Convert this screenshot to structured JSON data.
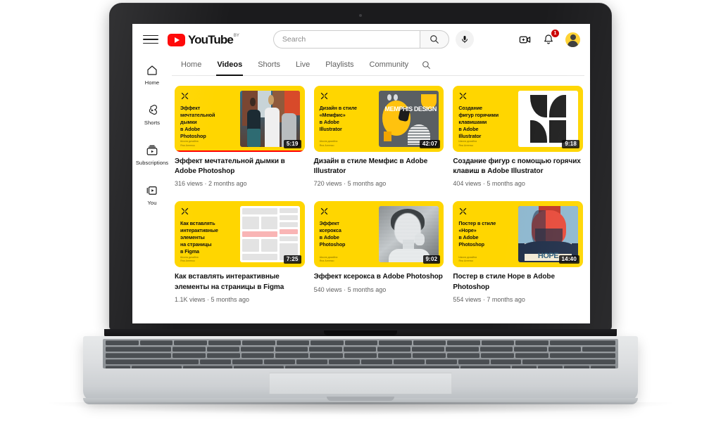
{
  "topbar": {
    "menu_icon": "hamburger-menu-icon",
    "logo_text": "YouTube",
    "logo_country_suffix": "BY",
    "search_placeholder": "Search",
    "search_value": "",
    "search_icon": "search-icon",
    "voice_icon": "microphone-icon",
    "create_icon": "create-video-icon",
    "notifications_icon": "bell-icon",
    "notifications_count": "1",
    "avatar_icon": "user-avatar"
  },
  "sidebar": {
    "items": [
      {
        "label": "Home",
        "icon": "home-icon"
      },
      {
        "label": "Shorts",
        "icon": "shorts-icon"
      },
      {
        "label": "Subscriptions",
        "icon": "subscriptions-icon"
      },
      {
        "label": "You",
        "icon": "you-library-icon"
      }
    ]
  },
  "channel_tabs": {
    "items": [
      {
        "label": "Home",
        "active": false
      },
      {
        "label": "Videos",
        "active": true
      },
      {
        "label": "Shorts",
        "active": false
      },
      {
        "label": "Live",
        "active": false
      },
      {
        "label": "Playlists",
        "active": false
      },
      {
        "label": "Community",
        "active": false
      }
    ],
    "search_icon": "search-icon"
  },
  "videos": [
    {
      "thumb_title": "Эффект\nмечтательной\nдымки\nв Adobe\nPhotoshop",
      "thumb_sub": "Школа дизайна\nЯна Агеенко",
      "duration": "5:19",
      "title": "Эффект мечтательной дымки в Adobe Photoshop",
      "meta": "316 views · 2 months ago",
      "progress_percent": 100,
      "art": "mural"
    },
    {
      "thumb_title": "Дизайн в стиле\n«Мемфис»\nв Adobe\nIllustrator",
      "thumb_sub": "Школа дизайна\nЯна Агеенко",
      "duration": "42:07",
      "title": "Дизайн в стиле Мемфис в Adobe Illustrator",
      "meta": "720 views · 5 months ago",
      "progress_percent": 0,
      "art": "memphis",
      "art_text": "MEMPHIS DESIGN"
    },
    {
      "thumb_title": "Создание\nфигур горячими\nклавишами\nв Adobe\nIllustrator",
      "thumb_sub": "Школа дизайна\nЯна Агеенко",
      "duration": "9:18",
      "title": "Создание фигур с помощью горячих клавиш в Adobe Illustrator",
      "meta": "404 views · 5 months ago",
      "progress_percent": 0,
      "art": "shapes"
    },
    {
      "thumb_title": "Как вставлять\nинтерактивные\nэлементы\nна страницы\nв Figma",
      "thumb_sub": "Школа дизайна\nЯна Агеенко",
      "duration": "7:25",
      "title": "Как вставлять интерактивные элементы на страницы в Figma",
      "meta": "1.1K views · 5 months ago",
      "progress_percent": 0,
      "art": "wireframe"
    },
    {
      "thumb_title": "Эффект\nксерокса\nв Adobe\nPhotoshop",
      "thumb_sub": "Школа дизайна\nЯна Агеенко",
      "duration": "9:02",
      "title": "Эффект ксерокса в Adobe Photoshop",
      "meta": "540 views · 5 months ago",
      "progress_percent": 0,
      "art": "xerox"
    },
    {
      "thumb_title": "Постер в стиле\n«Hope»\nв Adobe\nPhotoshop",
      "thumb_sub": "Школа дизайна\nЯна Агеенко",
      "duration": "14:40",
      "title": "Постер в стиле Hope в Adobe Photoshop",
      "meta": "554 views · 7 months ago",
      "progress_percent": 0,
      "art": "hope",
      "art_text": "HOPE"
    }
  ],
  "colors": {
    "brand_red": "#ff0000",
    "thumb_yellow": "#ffd600",
    "text_primary": "#0f0f0f",
    "text_secondary": "#606060",
    "badge_red": "#cc0000"
  }
}
